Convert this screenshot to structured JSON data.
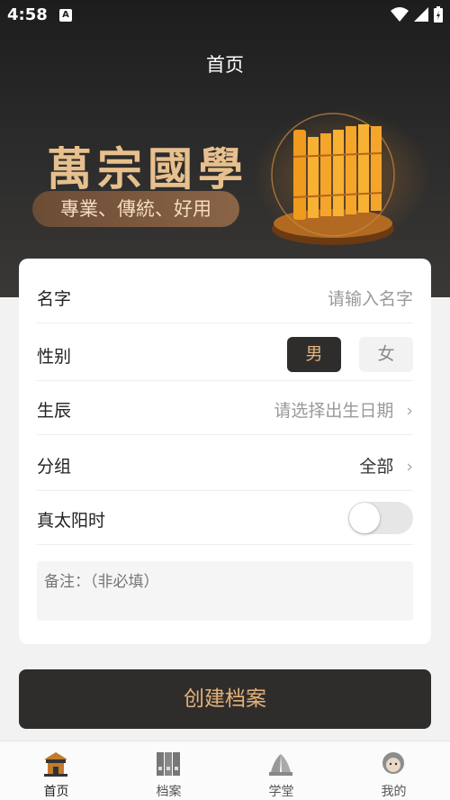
{
  "status_bar": {
    "time": "4:58",
    "notification_icon": "A"
  },
  "header": {
    "title": "首页"
  },
  "banner": {
    "brand": "萬宗國學",
    "slogan": "專業、傳統、好用"
  },
  "form": {
    "name_label": "名字",
    "name_placeholder": "请输入名字",
    "gender_label": "性别",
    "gender_male": "男",
    "gender_female": "女",
    "gender_selected": "男",
    "birth_label": "生辰",
    "birth_placeholder": "请选择出生日期",
    "group_label": "分组",
    "group_value": "全部",
    "solar_time_label": "真太阳时",
    "solar_time_on": false,
    "note_placeholder": "备注：（非必填）"
  },
  "create_button": "创建档案",
  "tabs": [
    {
      "label": "首页",
      "icon": "temple-icon",
      "active": true
    },
    {
      "label": "档案",
      "icon": "archive-icon",
      "active": false
    },
    {
      "label": "学堂",
      "icon": "school-icon",
      "active": false
    },
    {
      "label": "我的",
      "icon": "profile-icon",
      "active": false
    }
  ],
  "colors": {
    "accent": "#e2b27a",
    "dark": "#2f2d2c",
    "brand_gold": "#e7c08d"
  }
}
